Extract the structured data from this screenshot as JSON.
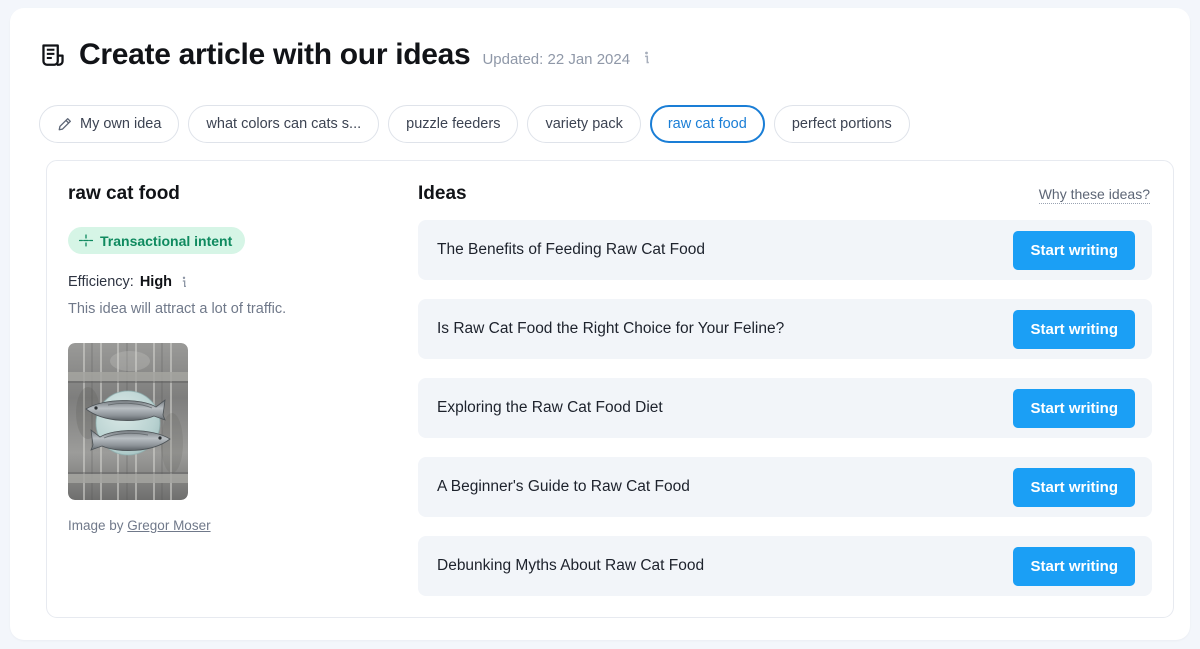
{
  "header": {
    "icon": "article-document-icon",
    "title": "Create article with our ideas",
    "updated_label": "Updated: 22 Jan 2024",
    "info_icon": "info-icon"
  },
  "tabs": [
    {
      "label": "My own idea",
      "icon": "pencil-icon",
      "active": false
    },
    {
      "label": "what colors can cats s...",
      "icon": "",
      "active": false
    },
    {
      "label": "puzzle feeders",
      "icon": "",
      "active": false
    },
    {
      "label": "variety pack",
      "icon": "",
      "active": false
    },
    {
      "label": "raw cat food",
      "icon": "",
      "active": true
    },
    {
      "label": "perfect portions",
      "icon": "",
      "active": false
    }
  ],
  "keyword_panel": {
    "title": "raw cat food",
    "intent_badge": "Transactional intent",
    "intent_icon": "intent-dashes-icon",
    "efficiency_label": "Efficiency:",
    "efficiency_value": "High",
    "efficiency_info_icon": "info-icon",
    "efficiency_description": "This idea will attract a lot of traffic.",
    "image_alt": "two fish on a pale blue plate over grey wooden planks",
    "credit_prefix": "Image by",
    "credit_author": "Gregor Moser"
  },
  "ideas_panel": {
    "title": "Ideas",
    "why_link": "Why these ideas?",
    "button_label": "Start writing",
    "items": [
      {
        "title": "The Benefits of Feeding Raw Cat Food",
        "button": "Start writing"
      },
      {
        "title": "Is Raw Cat Food the Right Choice for Your Feline?",
        "button": "Start writing"
      },
      {
        "title": "Exploring the Raw Cat Food Diet",
        "button": "Start writing"
      },
      {
        "title": "A Beginner's Guide to Raw Cat Food",
        "button": "Start writing"
      },
      {
        "title": "Debunking Myths About Raw Cat Food",
        "button": "Start writing"
      }
    ]
  },
  "colors": {
    "accent_blue": "#1b9ff5",
    "active_tab_blue": "#1a7ed6",
    "badge_bg": "#d6f5e6",
    "badge_text": "#0f8a5f",
    "row_bg": "#f2f5f9",
    "page_bg": "#f3f6fb"
  }
}
